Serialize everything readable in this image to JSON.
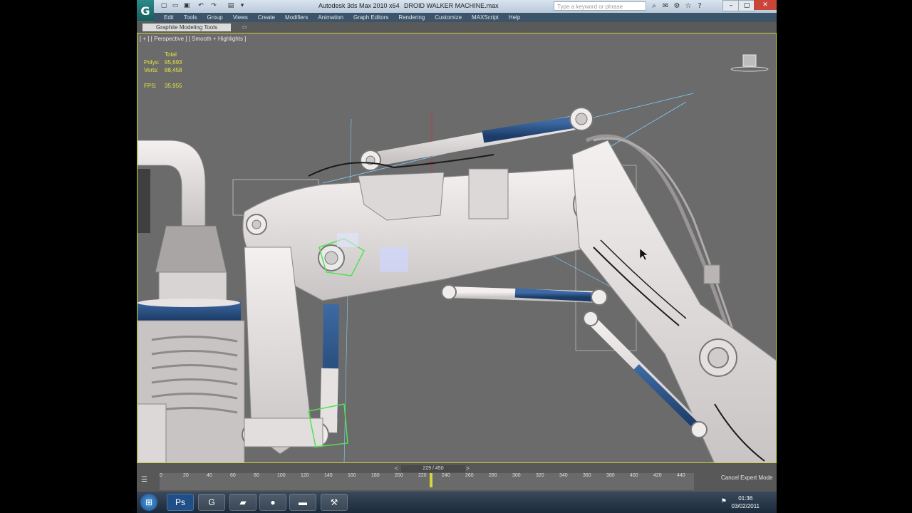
{
  "window": {
    "title": "Autodesk 3ds Max  2010 x64",
    "file": "DROID WALKER MACHINE.max",
    "search_placeholder": "Type a keyword or phrase"
  },
  "menu": [
    "Edit",
    "Tools",
    "Group",
    "Views",
    "Create",
    "Modifiers",
    "Animation",
    "Graph Editors",
    "Rendering",
    "Customize",
    "MAXScript",
    "Help"
  ],
  "ribbon": {
    "tab": "Graphite Modeling Tools"
  },
  "viewport": {
    "label": "[ + ] [ Perspective ] [ Smooth + Highlights ]",
    "stats": {
      "header": "Total",
      "polys_label": "Polys:",
      "polys": "95,693",
      "verts_label": "Verts:",
      "verts": "88,458",
      "fps_label": "FPS:",
      "fps": "35.955"
    }
  },
  "timeline": {
    "frame": "229 / 450",
    "ticks": [
      "0",
      "20",
      "40",
      "60",
      "80",
      "100",
      "120",
      "140",
      "160",
      "180",
      "200",
      "220",
      "240",
      "260",
      "280",
      "300",
      "320",
      "340",
      "360",
      "380",
      "400",
      "420",
      "440"
    ],
    "expert": "Cancel Expert Mode"
  },
  "taskbar": {
    "time": "01:36",
    "date": "03/02/2011",
    "apps": [
      "windows-start",
      "photoshop",
      "3dsmax",
      "folder",
      "firefox",
      "sticky-notes",
      "tool"
    ]
  }
}
